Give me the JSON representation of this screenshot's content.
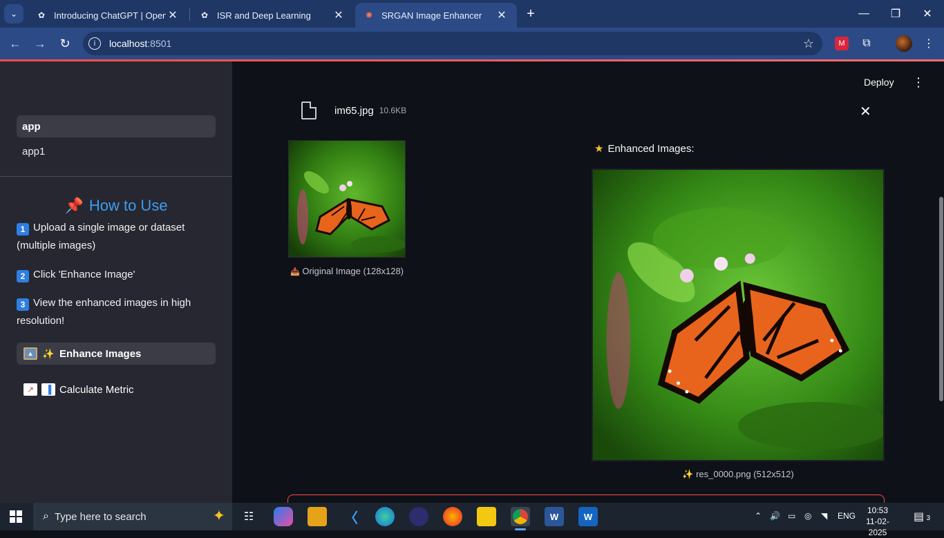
{
  "browser": {
    "tabs": [
      {
        "title": "Introducing ChatGPT | OpenAI",
        "icon": "openai-icon",
        "active": false
      },
      {
        "title": "ISR and Deep Learning",
        "icon": "openai-icon",
        "active": false
      },
      {
        "title": "SRGAN Image Enhancer",
        "icon": "streamlit-icon",
        "active": true
      }
    ],
    "url_host": "localhost",
    "url_port": ":8501"
  },
  "sidebar": {
    "nav": [
      {
        "label": "app",
        "active": true
      },
      {
        "label": "app1",
        "active": false
      }
    ],
    "howto_title": "How to Use",
    "steps": [
      {
        "num": "1",
        "text": "Upload a single image or dataset (multiple images)"
      },
      {
        "num": "2",
        "text": "Click 'Enhance Image'"
      },
      {
        "num": "3",
        "text": "View the enhanced images in high resolution!"
      }
    ],
    "buttons": [
      {
        "label": "Enhance Images"
      },
      {
        "label": "Calculate Metric"
      }
    ]
  },
  "main": {
    "deploy_label": "Deploy",
    "file_name": "im65.jpg",
    "file_size": "10.6KB",
    "original_caption": "Original Image (128x128)",
    "enhanced_title": "Enhanced Images:",
    "enhanced_caption": "res_0000.png (512x512)"
  },
  "taskbar": {
    "search_placeholder": "Type here to search",
    "lang": "ENG",
    "time": "10:53",
    "date": "11-02-2025",
    "notifications": "3"
  },
  "colors": {
    "accent": "#ff4b4b",
    "link_blue": "#3d9df3",
    "sidebar_bg": "#262730",
    "main_bg": "#0e1117"
  }
}
